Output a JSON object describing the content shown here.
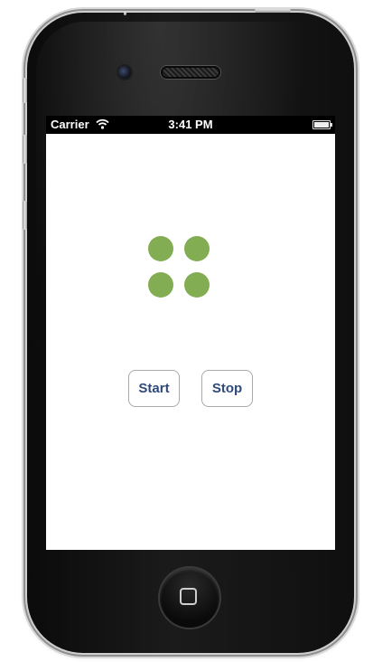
{
  "status_bar": {
    "carrier": "Carrier",
    "time": "3:41 PM",
    "wifi_icon": "wifi-icon",
    "battery_icon": "battery-icon"
  },
  "screen": {
    "background": "#ffffff",
    "dot_color": "#83ad53",
    "dot_count": 4
  },
  "controls": {
    "start_label": "Start",
    "stop_label": "Stop",
    "label_color": "#2f4a7a"
  },
  "device": {
    "home_icon": "home-button-icon"
  }
}
